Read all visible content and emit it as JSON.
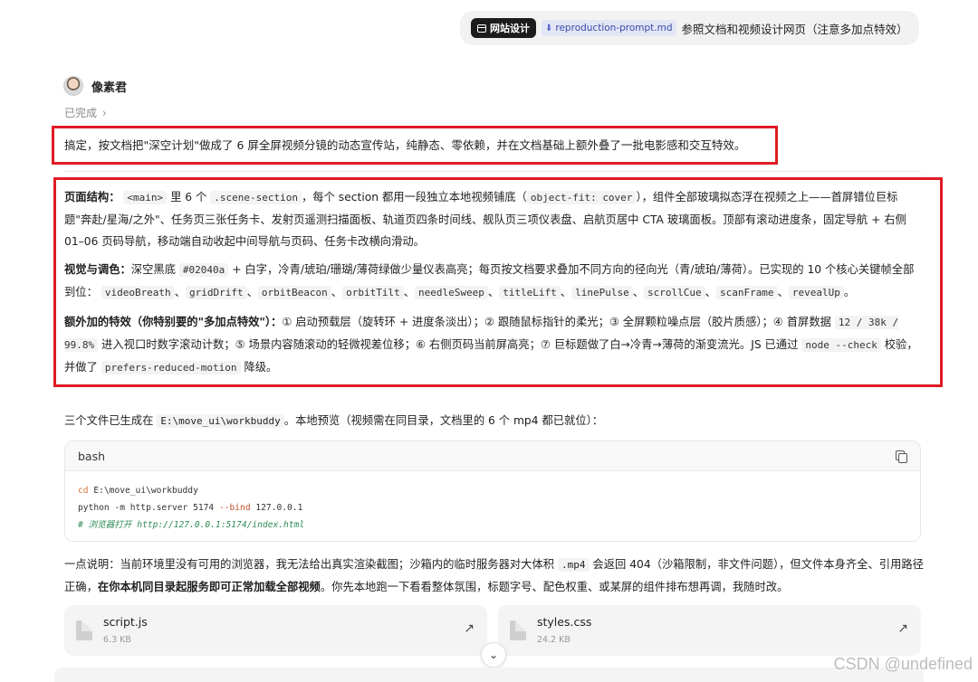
{
  "user_message": {
    "badge_label": "网站设计",
    "attachment": "reproduction-prompt.md",
    "text": "参照文档和视频设计网页（注意多加点特效）"
  },
  "assistant": {
    "name": "像素君",
    "status": "已完成",
    "status_chevron": "›"
  },
  "summary": "搞定，按文档把\"深空计划\"做成了 6 屏全屏视频分镜的动态宣传站，纯静态、零依赖，并在文档基础上额外叠了一批电影感和交互特效。",
  "page_structure": {
    "label": "页面结构：",
    "t1": "里 6 个",
    "code_main": "<main>",
    "code_section": ".scene-section",
    "t2": "，每个 section 都用一段独立本地视频铺底（",
    "code_fit": "object-fit: cover",
    "t3": "），组件全部玻璃拟态浮在视频之上——首屏错位巨标题\"奔赴/星海/之外\"、任务页三张任务卡、发射页遥测扫描面板、轨道页四条时间线、舰队页三项仪表盘、启航页居中 CTA 玻璃面板。顶部有滚动进度条，固定导航 + 右侧 01–06 页码导航，移动端自动收起中间导航与页码、任务卡改横向滑动。"
  },
  "visual": {
    "label": "视觉与调色：",
    "t1": "深空黑底",
    "code_color": "#02040a",
    "t2": "+ 白字，冷青/琥珀/珊瑚/薄荷绿做少量仪表高亮；每页按文档要求叠加不同方向的径向光（青/琥珀/薄荷）。已实现的 10 个核心关键帧全部到位：",
    "keyframes": [
      "videoBreath",
      "gridDrift",
      "orbitBeacon",
      "orbitTilt",
      "needleSweep",
      "titleLift",
      "linePulse",
      "scrollCue",
      "scanFrame",
      "revealUp"
    ],
    "sep": "、",
    "end": "。"
  },
  "extra": {
    "label": "额外加的特效（你特别要的\"多加点特效\"）：",
    "t1": "① 启动预载层（旋转环 + 进度条淡出）；② 跟随鼠标指针的柔光；③ 全屏颗粒噪点层（胶片质感）；④ 首屏数据",
    "code_stats": "12 / 38k / 99.8%",
    "t2": "进入视口时数字滚动计数；⑤ 场景内容随滚动的轻微视差位移；⑥ 右侧页码当前屏高亮；⑦ 巨标题做了白→冷青→薄荷的渐变流光。JS 已通过",
    "code_check": "node --check",
    "t3": "校验，并做了",
    "code_motion": "prefers-reduced-motion",
    "t4": "降级。"
  },
  "files_line": {
    "t1": "三个文件已生成在",
    "code_path": "E:\\move_ui\\workbuddy",
    "t2": "。本地预览（视频需在同目录，文档里的 6 个 mp4 都已就位）："
  },
  "codeblock": {
    "lang": "bash",
    "line1_kw": "cd",
    "line1_rest": " E:\\move_ui\\workbuddy",
    "line2_a": "python -m http.server 5174 ",
    "line2_flag": "--bind",
    "line2_b": " 127.0.0.1",
    "line3_comment": "# 浏览器打开 http://127.0.0.1:5174/index.html"
  },
  "note": {
    "t1": "一点说明：当前环境里没有可用的浏览器，我无法给出真实渲染截图；沙箱内的临时服务器对大体积",
    "code_mp4": ".mp4",
    "t2": "会返回 404（沙箱限制，非文件问题），但文件本身齐全、引用路径正确，",
    "bold": "在你本机同目录起服务即可正常加载全部视频",
    "t3": "。你先本地跑一下看看整体氛围，标题字号、配色权重、或某屏的组件排布想再调，我随时改。"
  },
  "files": [
    {
      "name": "script.js",
      "size": "6.3 KB"
    },
    {
      "name": "styles.css",
      "size": "24.2 KB"
    }
  ],
  "watermark": "CSDN @undefined"
}
